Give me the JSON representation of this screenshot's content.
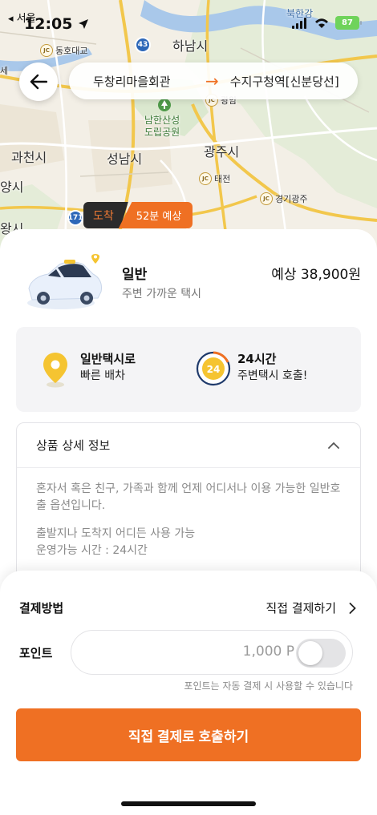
{
  "status_bar": {
    "time": "12:05",
    "back_app": "서울",
    "battery": "87"
  },
  "map": {
    "labels": {
      "hanam": "하남시",
      "gwacheon": "과천시",
      "seongnam": "성남시",
      "gwangju": "광주시",
      "bukhan": "북한강",
      "donghodaegyo": "동호대교",
      "namhansanseong": "남한산성\n도립공원",
      "gwangam": "광암",
      "taejeon": "태전",
      "gyeonggi_gwangju": "경기광주",
      "sejong_partial": "세",
      "yang_partial": "양시",
      "wang_partial": "왕시"
    },
    "route_badges": {
      "r43": "43",
      "r171": "171"
    }
  },
  "header": {
    "origin": "두창리마을회관",
    "destination": "수지구청역[신분당선]"
  },
  "arrival": {
    "label": "도착",
    "eta": "52분 예상"
  },
  "product": {
    "name": "일반",
    "subtitle": "주변 가까운 택시",
    "price": "예상 38,900원"
  },
  "features": [
    {
      "title": "일반택시로",
      "desc": "빠른 배차"
    },
    {
      "title": "24시간",
      "desc": "주변택시 호출!",
      "badge": "24"
    }
  ],
  "detail": {
    "title": "상품 상세 정보",
    "paragraphs": [
      "혼자서 혹은 친구, 가족과 함께 언제 어디서나 이용 가능한 일반호출 옵션입니다.",
      "출발지나 도착지 어디든 사용 가능\n운영가능 시간 : 24시간"
    ]
  },
  "payment": {
    "method_label": "결제방법",
    "method_value": "직접 결제하기",
    "points_label": "포인트",
    "points_value": "1,000 P",
    "points_toggle_on": false,
    "points_hint": "포인트는 자동 결제 시 사용할 수 있습니다",
    "call_button": "직접 결제로 호출하기"
  },
  "colors": {
    "accent": "#ef7023",
    "pin_yellow": "#f5c431",
    "navy": "#1f3a6b"
  }
}
